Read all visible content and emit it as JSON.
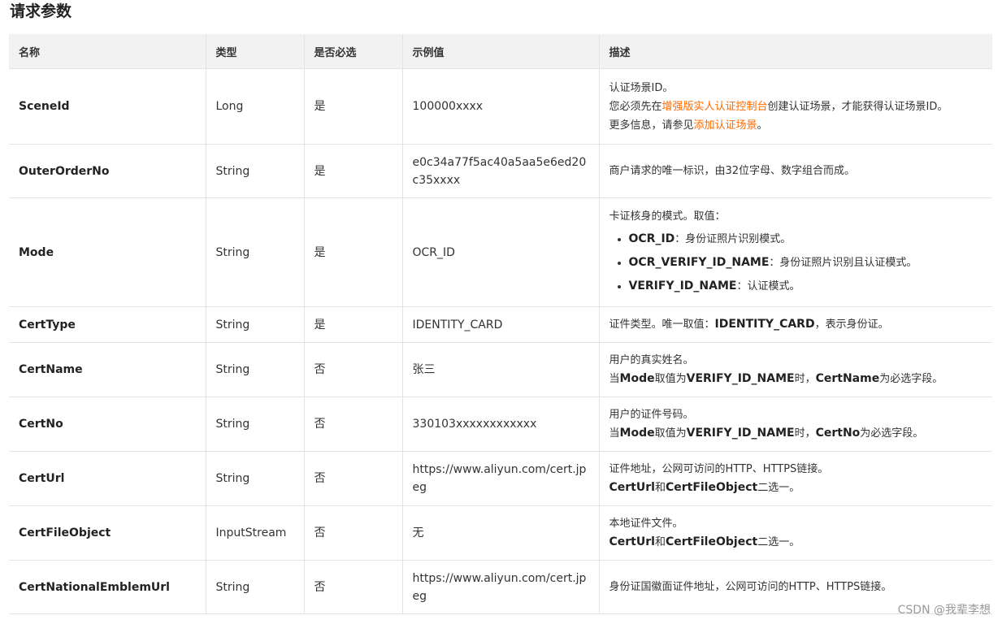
{
  "page": {
    "title": "请求参数",
    "watermark": "CSDN @我辈李想"
  },
  "table": {
    "headers": [
      "名称",
      "类型",
      "是否必选",
      "示例值",
      "描述"
    ],
    "rows": [
      {
        "name": "SceneId",
        "type": "Long",
        "required": "是",
        "example": "100000xxxx",
        "desc": {
          "l1": "认证场景ID。",
          "l2_pre": "您必须先在",
          "l2_link": "增强版实人认证控制台",
          "l2_post": "创建认证场景，才能获得认证场景ID。",
          "l3_pre": "更多信息，请参见",
          "l3_link": "添加认证场景",
          "l3_post": "。"
        }
      },
      {
        "name": "OuterOrderNo",
        "type": "String",
        "required": "是",
        "example": "e0c34a77f5ac40a5aa5e6ed20c35xxxx",
        "desc": {
          "l1": "商户请求的唯一标识，由32位字母、数字组合而成。"
        }
      },
      {
        "name": "Mode",
        "type": "String",
        "required": "是",
        "example": "OCR_ID",
        "desc": {
          "l1": "卡证核身的模式。取值：",
          "opts": [
            {
              "key": "OCR_ID",
              "text": "：身份证照片识别模式。"
            },
            {
              "key": "OCR_VERIFY_ID_NAME",
              "text": "：身份证照片识别且认证模式。"
            },
            {
              "key": "VERIFY_ID_NAME",
              "text": "：认证模式。"
            }
          ]
        }
      },
      {
        "name": "CertType",
        "type": "String",
        "required": "是",
        "example": "IDENTITY_CARD",
        "desc": {
          "pre": "证件类型。唯一取值：",
          "bold": "IDENTITY_CARD",
          "post": "，表示身份证。"
        }
      },
      {
        "name": "CertName",
        "type": "String",
        "required": "否",
        "example": "张三",
        "desc": {
          "l1": "用户的真实姓名。",
          "a": "当",
          "b1": "Mode",
          "c": "取值为",
          "b2": "VERIFY_ID_NAME",
          "d": "时，",
          "b3": "CertName",
          "e": "为必选字段。"
        }
      },
      {
        "name": "CertNo",
        "type": "String",
        "required": "否",
        "example": "330103xxxxxxxxxxxx",
        "desc": {
          "l1": "用户的证件号码。",
          "a": "当",
          "b1": "Mode",
          "c": "取值为",
          "b2": "VERIFY_ID_NAME",
          "d": "时，",
          "b3": "CertNo",
          "e": "为必选字段。"
        }
      },
      {
        "name": "CertUrl",
        "type": "String",
        "required": "否",
        "example": "https://www.aliyun.com/cert.jpeg",
        "desc": {
          "l1": "证件地址，公网可访问的HTTP、HTTPS链接。",
          "b1": "CertUrl",
          "m": "和",
          "b2": "CertFileObject",
          "e": "二选一。"
        }
      },
      {
        "name": "CertFileObject",
        "type": "InputStream",
        "required": "否",
        "example": "无",
        "desc": {
          "l1": "本地证件文件。",
          "b1": "CertUrl",
          "m": "和",
          "b2": "CertFileObject",
          "e": "二选一。"
        }
      },
      {
        "name": "CertNationalEmblemUrl",
        "type": "String",
        "required": "否",
        "example": "https://www.aliyun.com/cert.jpeg",
        "desc": {
          "l1": "身份证国徽面证件地址，公网可访问的HTTP、HTTPS链接。"
        }
      }
    ]
  },
  "colors": {
    "link": "#ff6a00",
    "header_bg": "#f2f2f2",
    "border": "#e3e3e3"
  }
}
